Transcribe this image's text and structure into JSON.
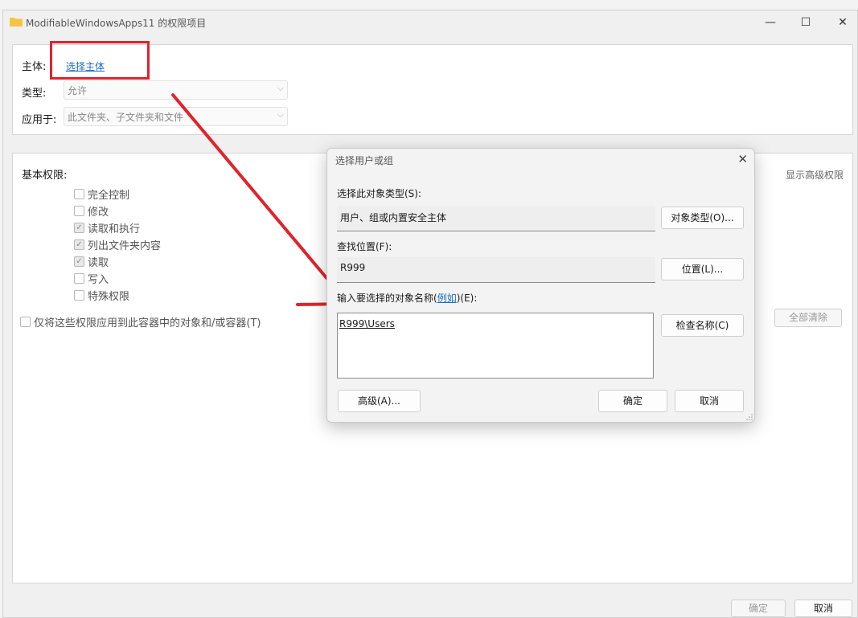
{
  "window": {
    "title": "ModifiableWindowsApps11 的权限项目",
    "minimize": "—",
    "maximize": "☐",
    "close": "✕"
  },
  "principal": {
    "label": "主体:",
    "link": "选择主体"
  },
  "type": {
    "label": "类型:",
    "value": "允许"
  },
  "applies": {
    "label": "应用于:",
    "value": "此文件夹、子文件夹和文件"
  },
  "permissions": {
    "heading": "基本权限:",
    "show_advanced": "显示高级权限",
    "items": [
      {
        "label": "完全控制",
        "checked": false
      },
      {
        "label": "修改",
        "checked": false
      },
      {
        "label": "读取和执行",
        "checked": true
      },
      {
        "label": "列出文件夹内容",
        "checked": true
      },
      {
        "label": "读取",
        "checked": true
      },
      {
        "label": "写入",
        "checked": false
      },
      {
        "label": "特殊权限",
        "checked": false
      }
    ],
    "apply_only": "仅将这些权限应用到此容器中的对象和/或容器(T)",
    "clear_all": "全部清除"
  },
  "footer": {
    "ok": "确定",
    "cancel": "取消"
  },
  "dialog": {
    "title": "选择用户或组",
    "object_type_label": "选择此对象类型(S):",
    "object_type_value": "用户、组或内置安全主体",
    "object_type_button": "对象类型(O)...",
    "location_label": "查找位置(F):",
    "location_value": "R999",
    "location_button": "位置(L)...",
    "names_label_pre": "输入要选择的对象名称(",
    "names_label_link": "例如",
    "names_label_post": ")(E):",
    "names_value": "R999\\Users",
    "check_names_button": "检查名称(C)",
    "advanced_button": "高级(A)...",
    "ok_button": "确定",
    "cancel_button": "取消"
  },
  "colors": {
    "annotation_red": "#e0232c",
    "link_blue": "#1a6fc4"
  }
}
